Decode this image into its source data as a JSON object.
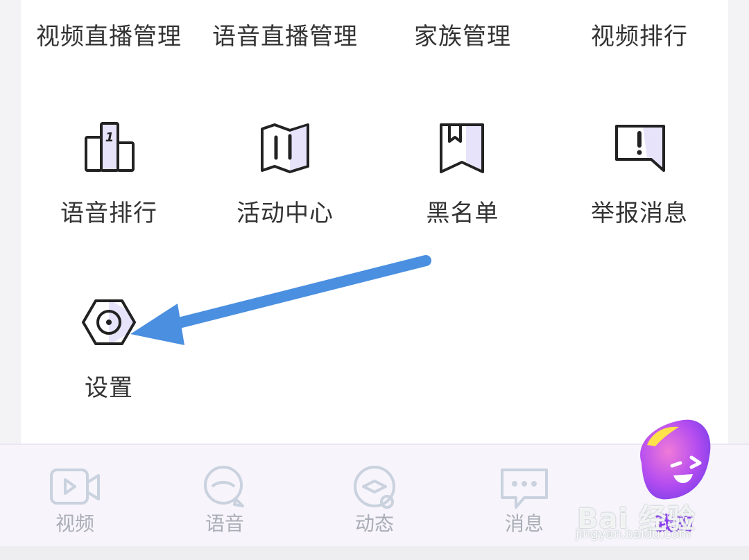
{
  "top_row": [
    "视频直播管理",
    "语音直播管理",
    "家族管理",
    "视频排行"
  ],
  "grid": [
    {
      "label": "语音排行",
      "icon": "podium-icon"
    },
    {
      "label": "活动中心",
      "icon": "map-icon"
    },
    {
      "label": "黑名单",
      "icon": "bookmark-icon"
    },
    {
      "label": "举报消息",
      "icon": "report-icon"
    },
    {
      "label": "设置",
      "icon": "settings-icon"
    }
  ],
  "tabs": [
    {
      "label": "视频",
      "icon": "video-icon"
    },
    {
      "label": "语音",
      "icon": "voice-icon"
    },
    {
      "label": "动态",
      "icon": "moments-icon"
    },
    {
      "label": "消息",
      "icon": "message-icon"
    },
    {
      "label": "我的",
      "icon": "mascot-icon"
    }
  ],
  "watermark": {
    "text": "Bai 经验",
    "sub": "jingyan.baidu.com"
  },
  "colors": {
    "accent": "#8c3ff0",
    "arrow": "#4a8fe0",
    "icon_fill": "#e6e3fb"
  }
}
